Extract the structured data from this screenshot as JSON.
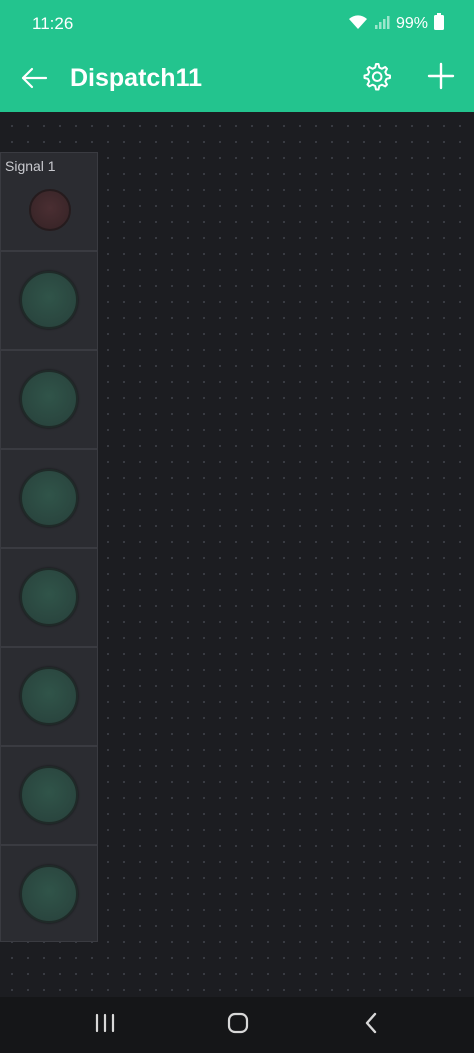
{
  "status_bar": {
    "time": "11:26",
    "battery": "99%",
    "icons": [
      "wifi-icon",
      "signal-icon",
      "battery-icon"
    ]
  },
  "app_bar": {
    "title": "Dispatch11",
    "icons": [
      "back-arrow-icon",
      "gear-icon",
      "plus-icon"
    ],
    "accent_color": "#23c48e"
  },
  "widgets": [
    {
      "label": "Signal 1",
      "led_state": "red-off"
    },
    {
      "label": "",
      "led_state": "green-off"
    },
    {
      "label": "",
      "led_state": "green-off"
    },
    {
      "label": "",
      "led_state": "green-off"
    },
    {
      "label": "",
      "led_state": "green-off"
    },
    {
      "label": "",
      "led_state": "green-off"
    },
    {
      "label": "",
      "led_state": "green-off"
    },
    {
      "label": "",
      "led_state": "green-off"
    }
  ],
  "nav_bar": {
    "icons": [
      "recents-icon",
      "home-icon",
      "back-icon"
    ]
  }
}
